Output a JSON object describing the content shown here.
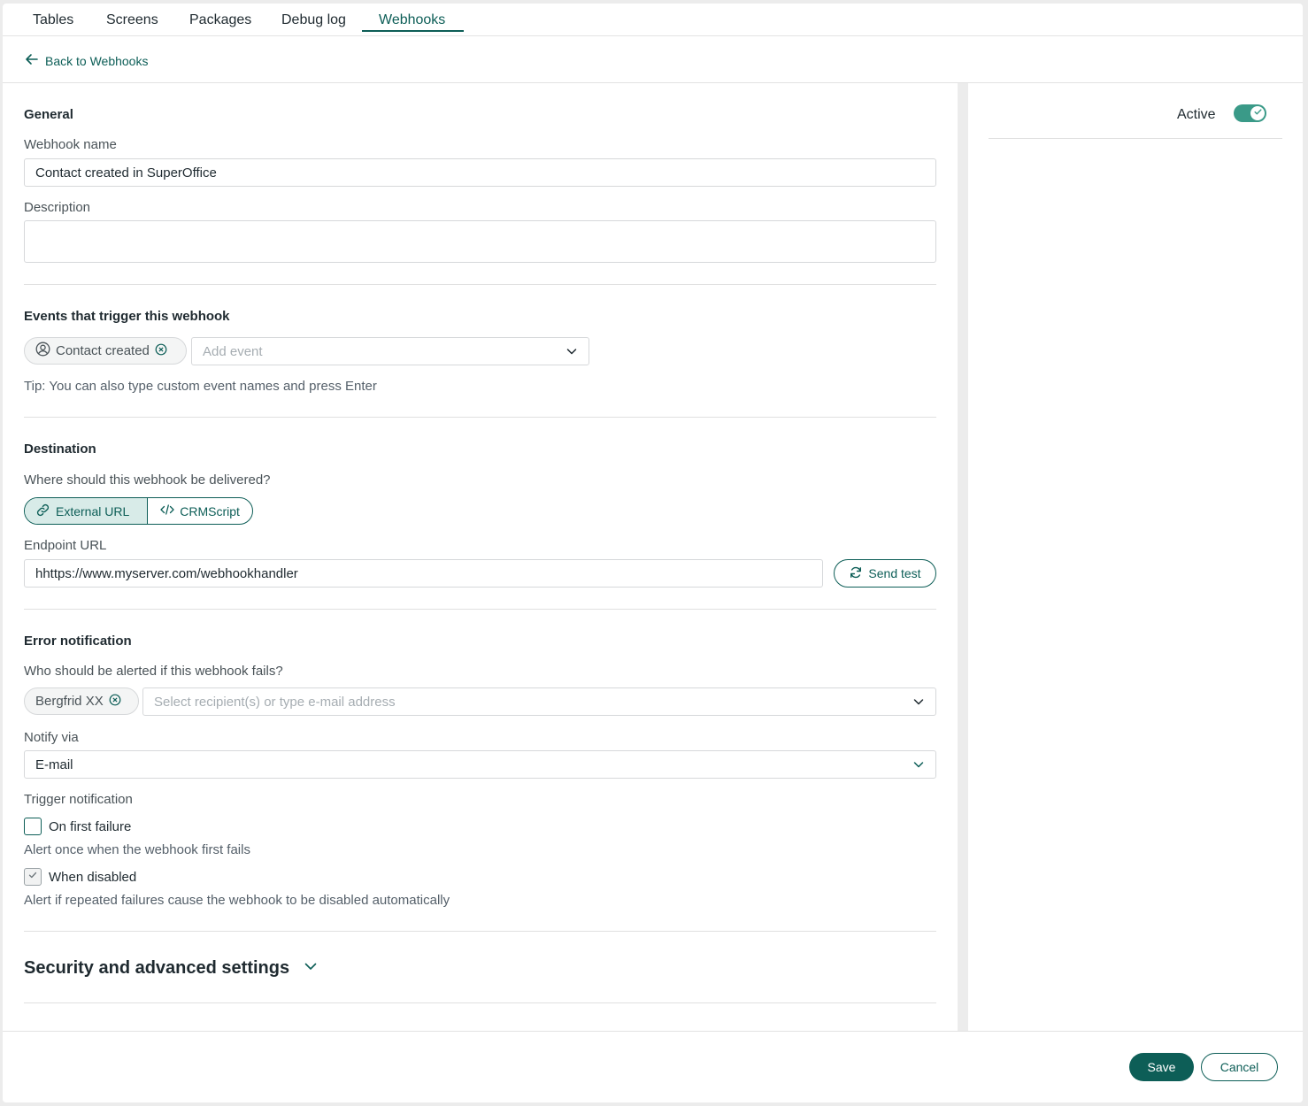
{
  "tabs": [
    {
      "label": "Tables",
      "active": false
    },
    {
      "label": "Screens",
      "active": false
    },
    {
      "label": "Packages",
      "active": false
    },
    {
      "label": "Debug log",
      "active": false
    },
    {
      "label": "Webhooks",
      "active": true
    }
  ],
  "back_link": "Back to Webhooks",
  "general": {
    "heading": "General",
    "name_label": "Webhook name",
    "name_value": "Contact created in SuperOffice",
    "description_label": "Description",
    "description_value": ""
  },
  "events": {
    "heading": "Events that trigger this webhook",
    "chip": "Contact created",
    "add_placeholder": "Add event",
    "tip": "Tip: You can also type custom event names and press Enter"
  },
  "destination": {
    "heading": "Destination",
    "question": "Where should this webhook be delivered?",
    "options": [
      "External URL",
      "CRMScript"
    ],
    "selected": "External URL",
    "endpoint_label": "Endpoint URL",
    "endpoint_value": "hhttps://www.myserver.com/webhookhandler",
    "send_test": "Send test"
  },
  "error_notification": {
    "heading": "Error notification",
    "question": "Who should be alerted if this webhook fails?",
    "recipient_chip": "Bergfrid XX",
    "recipient_placeholder": "Select recipient(s) or type e-mail address",
    "notify_label": "Notify via",
    "notify_value": "E-mail",
    "trigger_label": "Trigger notification",
    "first_failure": {
      "label": "On first failure",
      "checked": false,
      "hint": "Alert once when the webhook first fails"
    },
    "when_disabled": {
      "label": "When disabled",
      "checked": true,
      "hint": "Alert if repeated failures cause the webhook to be disabled automatically"
    }
  },
  "security": {
    "heading": "Security and advanced settings"
  },
  "side": {
    "active_label": "Active",
    "active": true
  },
  "footer": {
    "save": "Save",
    "cancel": "Cancel"
  },
  "colors": {
    "accent": "#0d5e57",
    "toggle": "#3a9a88",
    "chip_bg": "#f4f5f5"
  }
}
